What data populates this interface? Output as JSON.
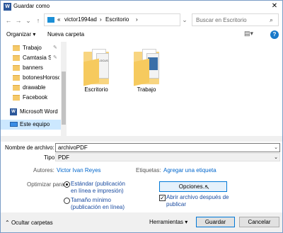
{
  "window": {
    "title": "Guardar como",
    "app_icon_letter": "W"
  },
  "nav": {
    "breadcrumb": [
      "«",
      "victor1994ad",
      "›",
      "Escritorio",
      "›"
    ],
    "search_placeholder": "Buscar en Escritorio"
  },
  "toolbar": {
    "organize": "Organizar ▾",
    "new_folder": "Nueva carpeta",
    "help": "?"
  },
  "sidebar": {
    "items": [
      {
        "label": "Trabajo",
        "pinned": true
      },
      {
        "label": "Camtasia Stu",
        "pinned": true
      },
      {
        "label": "banners",
        "pinned": false
      },
      {
        "label": "botonesHorosco",
        "pinned": false
      },
      {
        "label": "drawable",
        "pinned": false
      },
      {
        "label": "Facebook",
        "pinned": false
      },
      {
        "label": "Microsoft Word",
        "pinned": false
      },
      {
        "label": "Este equipo",
        "pinned": false,
        "selected": true
      }
    ]
  },
  "folders": [
    {
      "label": "Escritorio",
      "preview_text": "LOCUS"
    },
    {
      "label": "Trabajo",
      "preview_text": ""
    }
  ],
  "form": {
    "filename_label": "Nombre de archivo:",
    "filename_value": "archivoPDF",
    "type_label": "Tipo:",
    "type_value": "PDF",
    "authors_label": "Autores:",
    "authors_value": "Victor Ivan Reyes",
    "tags_label": "Etiquetas:",
    "tags_value": "Agregar una etiqueta",
    "optimize_label": "Optimizar para:",
    "opt_standard": [
      "Estándar (publicación",
      "en línea e impresión)"
    ],
    "opt_min": [
      "Tamaño mínimo",
      "(publicación en línea)"
    ],
    "options_button": "Opciones...",
    "open_after": [
      "Abrir archivo después de",
      "publicar"
    ],
    "open_after_checked": true
  },
  "footer": {
    "hide_folders": "Ocultar carpetas",
    "tools": "Herramientas",
    "save": "Guardar",
    "cancel": "Cancelar"
  },
  "colors": {
    "accent": "#0078d7",
    "link": "#0066cc",
    "selection": "#cce8ff"
  }
}
